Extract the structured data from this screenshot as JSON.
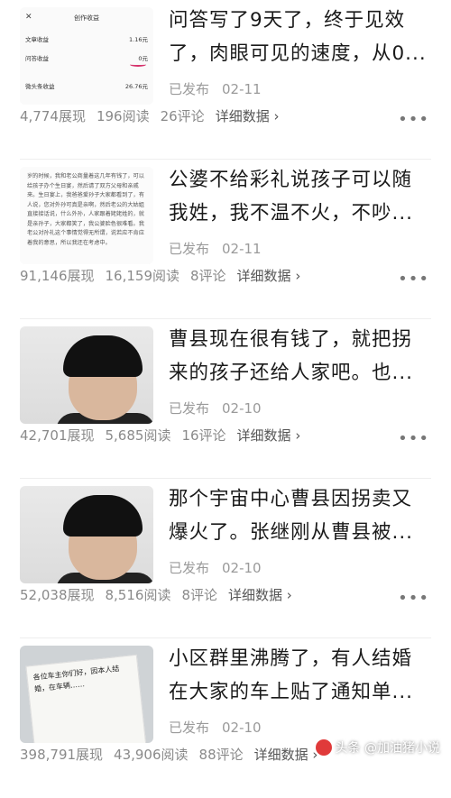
{
  "articles": [
    {
      "title_line1": "问答写了9天了，终于见效",
      "title_line2": "了，肉眼可见的速度，从0...",
      "status": "已发布",
      "date": "02-11",
      "views": "4,774展现",
      "reads": "196阅读",
      "comments": "26评论",
      "detail": "详细数据 ›",
      "more": "•••",
      "thumbnail": {
        "header": "创作收益",
        "rows": [
          {
            "label": "文章收益",
            "value": "1.16元"
          },
          {
            "label": "问答收益",
            "value": "0元"
          },
          {
            "label": "微头条收益",
            "value": "26.76元"
          }
        ]
      }
    },
    {
      "title_line1": "公婆不给彩礼说孩子可以随",
      "title_line2": "我姓，我不温不火，不吵...",
      "status": "已发布",
      "date": "02-11",
      "views": "91,146展现",
      "reads": "16,159阅读",
      "comments": "8评论",
      "detail": "详细数据 ›",
      "more": "•••",
      "thumbnail_text": "岁的时候，我和老公商量着这几年有钱了，可以给孩子办个生日宴，然后请了双方父母和亲戚来。生日宴上，我爸爸爱孙子大家都看到了，有人说，您对外孙可真是亲啊，然后老公的大姑姐直接接话说，什么外孙，人家跟着姥姥姓的，就是亲孙子，大家都笑了，我公婆脸色很难看。我老公对孙礼这个事情觉得无所谓，说若应不肯应着我的意思，所以我还在考虑中。"
    },
    {
      "title_line1": "曹县现在很有钱了，就把拐",
      "title_line2": "来的孩子还给人家吧。也...",
      "status": "已发布",
      "date": "02-10",
      "views": "42,701展现",
      "reads": "5,685阅读",
      "comments": "16评论",
      "detail": "详细数据 ›",
      "more": "•••"
    },
    {
      "title_line1": "那个宇宙中心曹县因拐卖又",
      "title_line2": "爆火了。张继刚从曹县被...",
      "status": "已发布",
      "date": "02-10",
      "views": "52,038展现",
      "reads": "8,516阅读",
      "comments": "8评论",
      "detail": "详细数据 ›",
      "more": "•••"
    },
    {
      "title_line1": "小区群里沸腾了，有人结婚",
      "title_line2": "在大家的车上贴了通知单...",
      "status": "已发布",
      "date": "02-10",
      "views": "398,791展现",
      "reads": "43,906阅读",
      "comments": "88评论",
      "detail": "详细数据 ›",
      "more": "•••",
      "thumbnail_text": "各位车主你们好，因本人结婚，在车辆……"
    }
  ],
  "watermark": "头条 @加油猪小说"
}
